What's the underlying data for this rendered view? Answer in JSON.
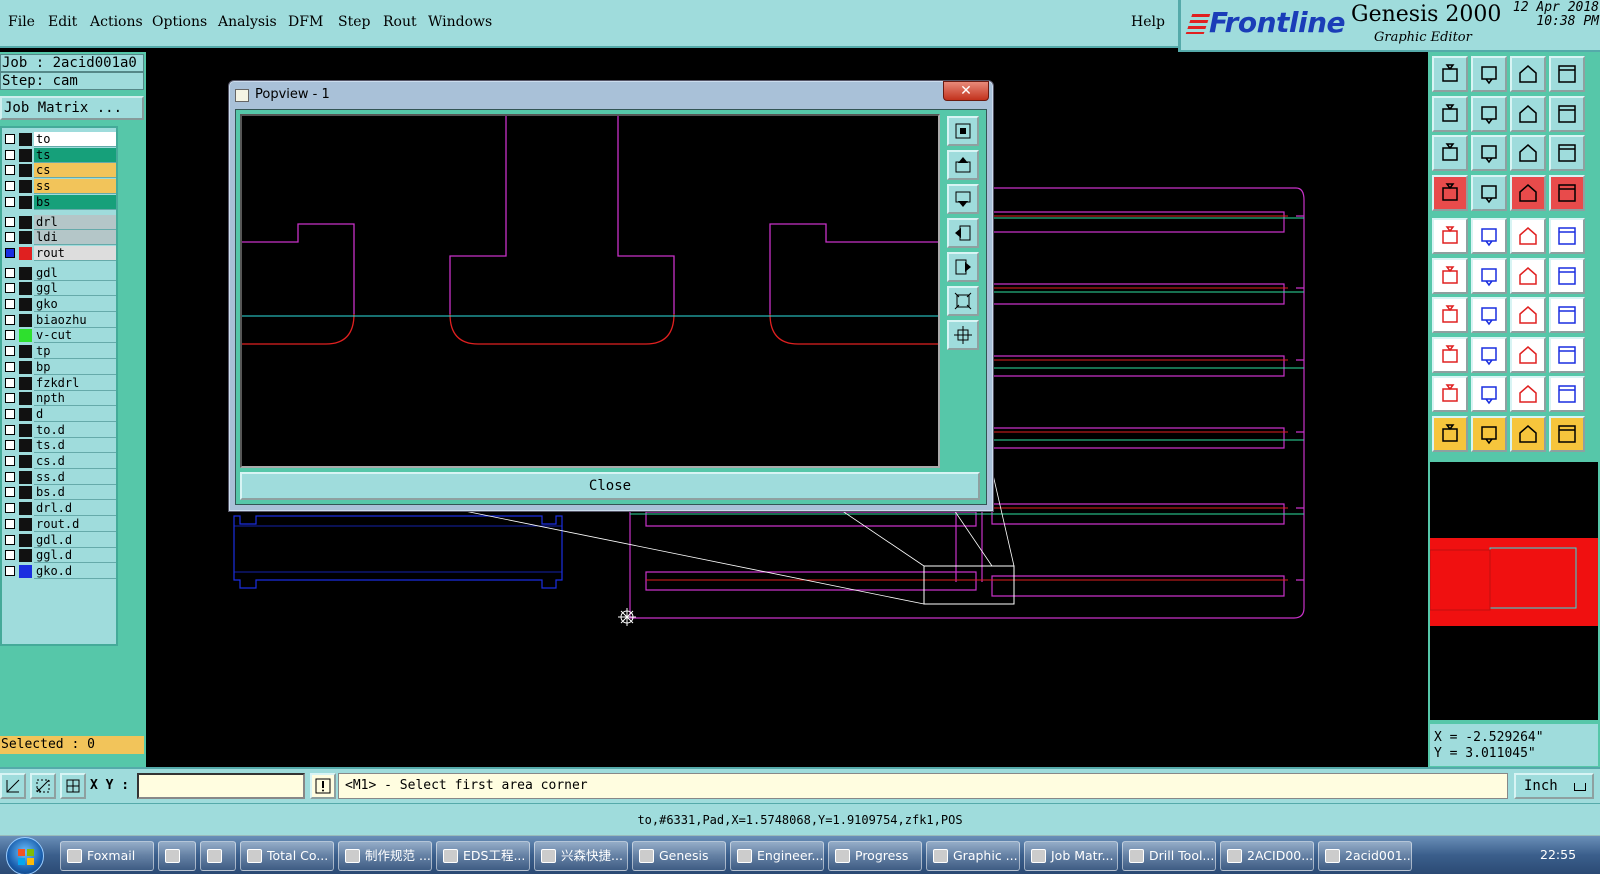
{
  "menu": {
    "file": "File",
    "edit": "Edit",
    "actions": "Actions",
    "options": "Options",
    "analysis": "Analysis",
    "dfm": "DFM",
    "step": "Step",
    "rout": "Rout",
    "windows": "Windows",
    "help": "Help"
  },
  "brand": {
    "logo": "Frontline",
    "title": "Genesis 2000",
    "subtitle": "Graphic Editor",
    "date": "12 Apr 2018",
    "time": "10:38 PM"
  },
  "job": {
    "job_line": "Job : 2acid001a0",
    "step_line": "Step: cam",
    "matrix_button": "Job Matrix ..."
  },
  "layers": [
    {
      "name": "to",
      "color": "#ffffff",
      "swatch": ""
    },
    {
      "name": "ts",
      "color": "#16a07a",
      "swatch": ""
    },
    {
      "name": "cs",
      "color": "#f2c45a",
      "swatch": ""
    },
    {
      "name": "ss",
      "color": "#f2c45a",
      "swatch": ""
    },
    {
      "name": "bs",
      "color": "#16a07a",
      "swatch": ""
    },
    {
      "name": "drl",
      "color": "#b4c6c8",
      "swatch": ""
    },
    {
      "name": "ldi",
      "color": "#b4c6c8",
      "swatch": ""
    },
    {
      "name": "rout",
      "color": "#dddddd",
      "swatch": "#e02020"
    },
    {
      "name": "gdl",
      "color": "#9fdcdc",
      "swatch": ""
    },
    {
      "name": "ggl",
      "color": "#9fdcdc",
      "swatch": ""
    },
    {
      "name": "gko",
      "color": "#9fdcdc",
      "swatch": ""
    },
    {
      "name": "biaozhu",
      "color": "#9fdcdc",
      "swatch": ""
    },
    {
      "name": "v-cut",
      "color": "#9fdcdc",
      "swatch": "#2ee02e"
    },
    {
      "name": "tp",
      "color": "#9fdcdc",
      "swatch": ""
    },
    {
      "name": "bp",
      "color": "#9fdcdc",
      "swatch": ""
    },
    {
      "name": "fzkdrl",
      "color": "#9fdcdc",
      "swatch": ""
    },
    {
      "name": "npth",
      "color": "#9fdcdc",
      "swatch": ""
    },
    {
      "name": "d",
      "color": "#9fdcdc",
      "swatch": ""
    },
    {
      "name": "to.d",
      "color": "#9fdcdc",
      "swatch": ""
    },
    {
      "name": "ts.d",
      "color": "#9fdcdc",
      "swatch": ""
    },
    {
      "name": "cs.d",
      "color": "#9fdcdc",
      "swatch": ""
    },
    {
      "name": "ss.d",
      "color": "#9fdcdc",
      "swatch": ""
    },
    {
      "name": "bs.d",
      "color": "#9fdcdc",
      "swatch": ""
    },
    {
      "name": "drl.d",
      "color": "#9fdcdc",
      "swatch": ""
    },
    {
      "name": "rout.d",
      "color": "#9fdcdc",
      "swatch": ""
    },
    {
      "name": "gdl.d",
      "color": "#9fdcdc",
      "swatch": ""
    },
    {
      "name": "ggl.d",
      "color": "#9fdcdc",
      "swatch": ""
    },
    {
      "name": "gko.d",
      "color": "#9fdcdc",
      "swatch": "#1a2ee0"
    }
  ],
  "selected": "Selected : 0",
  "popview": {
    "title": "Popview - 1",
    "close_x": "✕",
    "close_button": "Close"
  },
  "coords": {
    "x": "X = -2.529264\"",
    "y": "Y = 3.011045\""
  },
  "command": {
    "xy_label": "X Y :",
    "xy_value": "",
    "prompt": "<M1> - Select first area corner",
    "units": "Inch"
  },
  "status": "to,#6331,Pad,X=1.5748068,Y=1.9109754,zfk1,POS",
  "taskbar": {
    "items": [
      "Foxmail",
      "",
      "",
      "Total Co...",
      "制作规范 ...",
      "EDS工程...",
      "兴森快捷...",
      "Genesis",
      "Engineer...",
      "Progress",
      "Graphic ...",
      "Job Matr...",
      "Drill Tool...",
      "2ACID00...",
      "2acid001..."
    ],
    "time": "22:55"
  },
  "colors": {
    "panel": "#9fdcdc",
    "panel_dark": "#56c7a9",
    "rout_line": "#c832c8",
    "vcut_line": "#2ee0a0",
    "outline_red": "#e02020",
    "gko_line": "#1a2ee0"
  }
}
